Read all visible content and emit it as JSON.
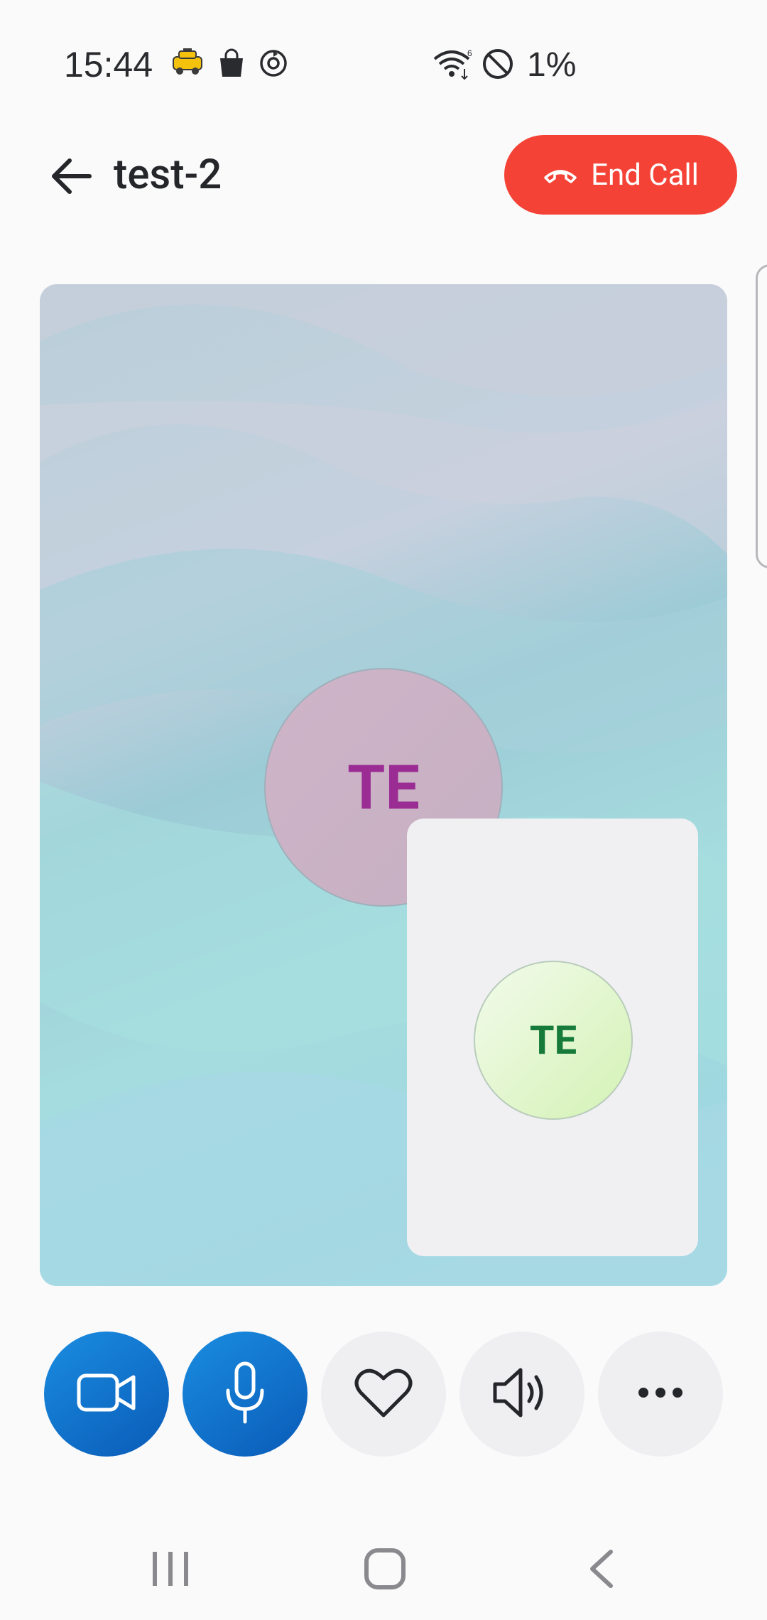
{
  "status_bar": {
    "time": "15:44",
    "battery": "1%",
    "icons_left": [
      "taxi-icon",
      "shopping-bag-icon",
      "sync-icon"
    ],
    "icons_right": [
      "wifi-icon",
      "do-not-disturb-icon"
    ]
  },
  "header": {
    "back_icon": "arrow-left-icon",
    "title": "test-2",
    "end_call_label": "End Call",
    "end_call_color": "#f44336"
  },
  "main_video": {
    "participant_initials": "TE",
    "initials_color": "#9a2c94"
  },
  "self_view": {
    "initials": "TE",
    "initials_color": "#157a3a"
  },
  "controls": [
    {
      "name": "camera",
      "icon": "video-camera-icon",
      "active": true
    },
    {
      "name": "microphone",
      "icon": "microphone-icon",
      "active": true
    },
    {
      "name": "reaction",
      "icon": "heart-icon",
      "active": false
    },
    {
      "name": "speaker",
      "icon": "speaker-icon",
      "active": false
    },
    {
      "name": "more",
      "icon": "more-dots-icon",
      "active": false
    }
  ],
  "accent_color": "#0a6fd0",
  "nav_bar": [
    "recents-icon",
    "home-icon",
    "back-icon"
  ]
}
